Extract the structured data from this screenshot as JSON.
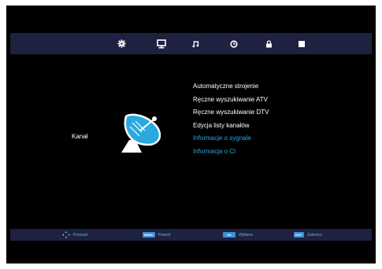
{
  "top_icons": [
    "gear-icon",
    "monitor-icon",
    "music-note-icon",
    "clock-icon",
    "lock-icon",
    "square-icon"
  ],
  "section_label": "Kanał",
  "menu_items": [
    {
      "label": "Automatyczne strojenie",
      "state": "enabled"
    },
    {
      "label": "Ręczne wyszukiwanie ATV",
      "state": "enabled"
    },
    {
      "label": "Ręczne wyszukiwanie DTV",
      "state": "enabled"
    },
    {
      "label": "Edycja listy kanałów",
      "state": "enabled"
    },
    {
      "label": "Informacje o sygnale",
      "state": "disabled"
    },
    {
      "label": "Informacja o CI",
      "state": "disabled"
    }
  ],
  "footer": {
    "move_icon": "move-arrows-icon",
    "move_label": "Przesuń",
    "menu_key": "MENU",
    "menu_label": "Powrót",
    "ok_key": "OK",
    "ok_label": "Wybierz",
    "exit_key": "EXIT",
    "exit_label": "Zakończ"
  },
  "colors": {
    "bar_background": "#1e2140",
    "menu_text": "#ffffff",
    "menu_text_disabled": "#2aa9e0",
    "hint_text": "#5ab8ea",
    "key_badge": "#3b8fd6",
    "dish": "#2aa9e0"
  }
}
